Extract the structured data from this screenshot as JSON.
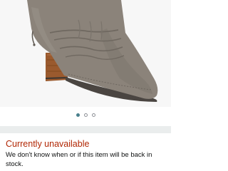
{
  "product": {
    "image_name": "suede-slouch-boot",
    "image_count": 3,
    "active_image": 1
  },
  "availability": {
    "status": "Currently unavailable",
    "message": "We don't know when or if this item will be back in stock."
  },
  "colors": {
    "status": "#B12704",
    "active_dot": "#49808D",
    "boot_suede": "#8B837A",
    "boot_heel": "#9A5A2E"
  }
}
